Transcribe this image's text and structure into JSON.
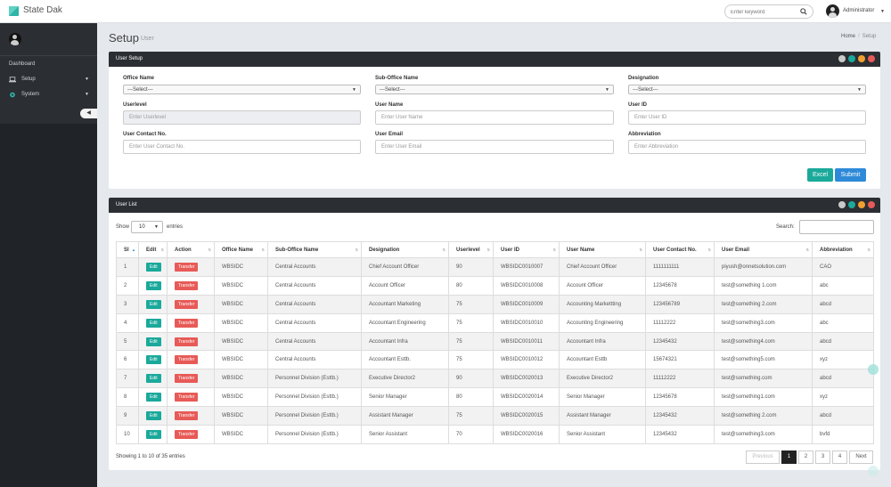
{
  "app": {
    "title": "State Dak"
  },
  "topbar": {
    "search_placeholder": "Enter keyword",
    "user_name": "Administrator"
  },
  "sidebar": {
    "items": [
      {
        "label": "Dashboard"
      },
      {
        "label": "Setup"
      },
      {
        "label": "System"
      }
    ]
  },
  "page": {
    "title": "Setup",
    "subtitle": "User",
    "breadcrumb": [
      "Home",
      "Setup"
    ]
  },
  "colors": {
    "teal": "#1aa99b",
    "red": "#e85a57",
    "blue": "#2e8ad8",
    "dark": "#2b2e33"
  },
  "user_setup": {
    "title": "User Setup",
    "fields": {
      "office_name": {
        "label": "Office Name",
        "value": "---Select---"
      },
      "sub_office_name": {
        "label": "Sub-Office Name",
        "value": "---Select---"
      },
      "designation": {
        "label": "Designation",
        "value": "---Select---"
      },
      "userlevel": {
        "label": "Userlevel",
        "placeholder": "Enter Userlevel"
      },
      "user_name": {
        "label": "User Name",
        "placeholder": "Enter User Name"
      },
      "user_id": {
        "label": "User ID",
        "placeholder": "Enter User ID"
      },
      "user_contact": {
        "label": "User Contact No.",
        "placeholder": "Enter User Contact No."
      },
      "user_email": {
        "label": "User Email",
        "placeholder": "Enter User Email"
      },
      "abbreviation": {
        "label": "Abbreviation",
        "placeholder": "Enter Abbreviation"
      }
    },
    "excel_label": "Excel",
    "submit_label": "Submit"
  },
  "user_list": {
    "title": "User List",
    "show_label": "Show",
    "entries_value": "10",
    "entries_label": "entries",
    "search_label": "Search:",
    "columns": [
      "Sl",
      "Edit",
      "Action",
      "Office Name",
      "Sub-Office Name",
      "Designation",
      "Userlevel",
      "User ID",
      "User Name",
      "User Contact No.",
      "User Email",
      "Abbreviation"
    ],
    "rows": [
      [
        "1",
        "Edit",
        "Transfer",
        "WBSIDC",
        "Central Accounts",
        "Chief Account Officer",
        "90",
        "WBSIDC0010007",
        "Chief Account Officer",
        "1111111111",
        "piyush@onnetsolution.com",
        "CAO"
      ],
      [
        "2",
        "Edit",
        "Transfer",
        "WBSIDC",
        "Central Accounts",
        "Account Officer",
        "80",
        "WBSIDC0010008",
        "Account Officer",
        "12345678",
        "test@something 1.com",
        "abc"
      ],
      [
        "3",
        "Edit",
        "Transfer",
        "WBSIDC",
        "Central Accounts",
        "Accountant Marketing",
        "75",
        "WBSIDC0010009",
        "Accounting Markettting",
        "123456789",
        "test@something 2.com",
        "abcd"
      ],
      [
        "4",
        "Edit",
        "Transfer",
        "WBSIDC",
        "Central Accounts",
        "Accountant Engineering",
        "75",
        "WBSIDC0010010",
        "Accounting Engineering",
        "11112222",
        "test@something3.com",
        "abc"
      ],
      [
        "5",
        "Edit",
        "Transfer",
        "WBSIDC",
        "Central Accounts",
        "Accountant Infra",
        "75",
        "WBSIDC0010011",
        "Accountant Infra",
        "12345432",
        "test@something4.com",
        "abcd"
      ],
      [
        "6",
        "Edit",
        "Transfer",
        "WBSIDC",
        "Central Accounts",
        "Accountant Esttb.",
        "75",
        "WBSIDC0010012",
        "Accountant Esttb",
        "15674321",
        "test@something5.com",
        "xyz"
      ],
      [
        "7",
        "Edit",
        "Transfer",
        "WBSIDC",
        "Personnel Division (Esttb.)",
        "Executive Director2",
        "90",
        "WBSIDC0020013",
        "Executive Director2",
        "11112222",
        "test@something.com",
        "abcd"
      ],
      [
        "8",
        "Edit",
        "Transfer",
        "WBSIDC",
        "Personnel Division (Esttb.)",
        "Senior Manager",
        "80",
        "WBSIDC0020014",
        "Senior Manager",
        "12345678",
        "test@something1.com",
        "xyz"
      ],
      [
        "9",
        "Edit",
        "Transfer",
        "WBSIDC",
        "Personnel Division (Esttb.)",
        "Assistant Manager",
        "75",
        "WBSIDC0020015",
        "Assistant Manager",
        "12345432",
        "test@something 2.com",
        "abcd"
      ],
      [
        "10",
        "Edit",
        "Transfer",
        "WBSIDC",
        "Personnel Division (Esttb.)",
        "Senior Assistant",
        "70",
        "WBSIDC0020016",
        "Senior Assistant",
        "12345432",
        "test@something3.com",
        "bvfd"
      ]
    ],
    "info": "Showing 1 to 10 of 35 entries",
    "pagination": {
      "previous": "Previous",
      "pages": [
        "1",
        "2",
        "3",
        "4"
      ],
      "next": "Next",
      "current": "1"
    }
  }
}
